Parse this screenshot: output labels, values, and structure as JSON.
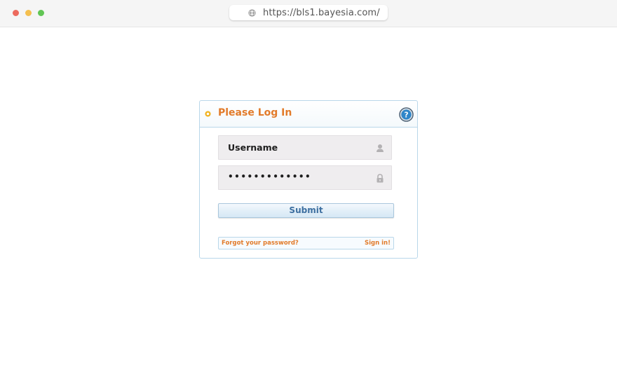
{
  "browser": {
    "url": "https://bls1.bayesia.com/",
    "icons": {
      "close": "red-dot",
      "minimize": "yellow-dot",
      "maximize": "green-dot",
      "site": "globe-icon"
    },
    "colors": {
      "close": "#ec6a5e",
      "minimize": "#f4bf4f",
      "maximize": "#61c554"
    }
  },
  "login": {
    "title": "Please Log In",
    "username_value": "Username",
    "password_value": "•••••••••••••",
    "submit_label": "Submit",
    "forgot_label": "Forgot your password?",
    "signin_label": "Sign in!",
    "icons": {
      "bullet": "bullet-icon",
      "help": "help-icon",
      "user": "user-icon",
      "lock": "lock-icon"
    },
    "colors": {
      "accent": "#e27b2a",
      "border": "#b9d7ea",
      "field_bg": "#efedef",
      "button_text": "#3d6fa0"
    }
  }
}
